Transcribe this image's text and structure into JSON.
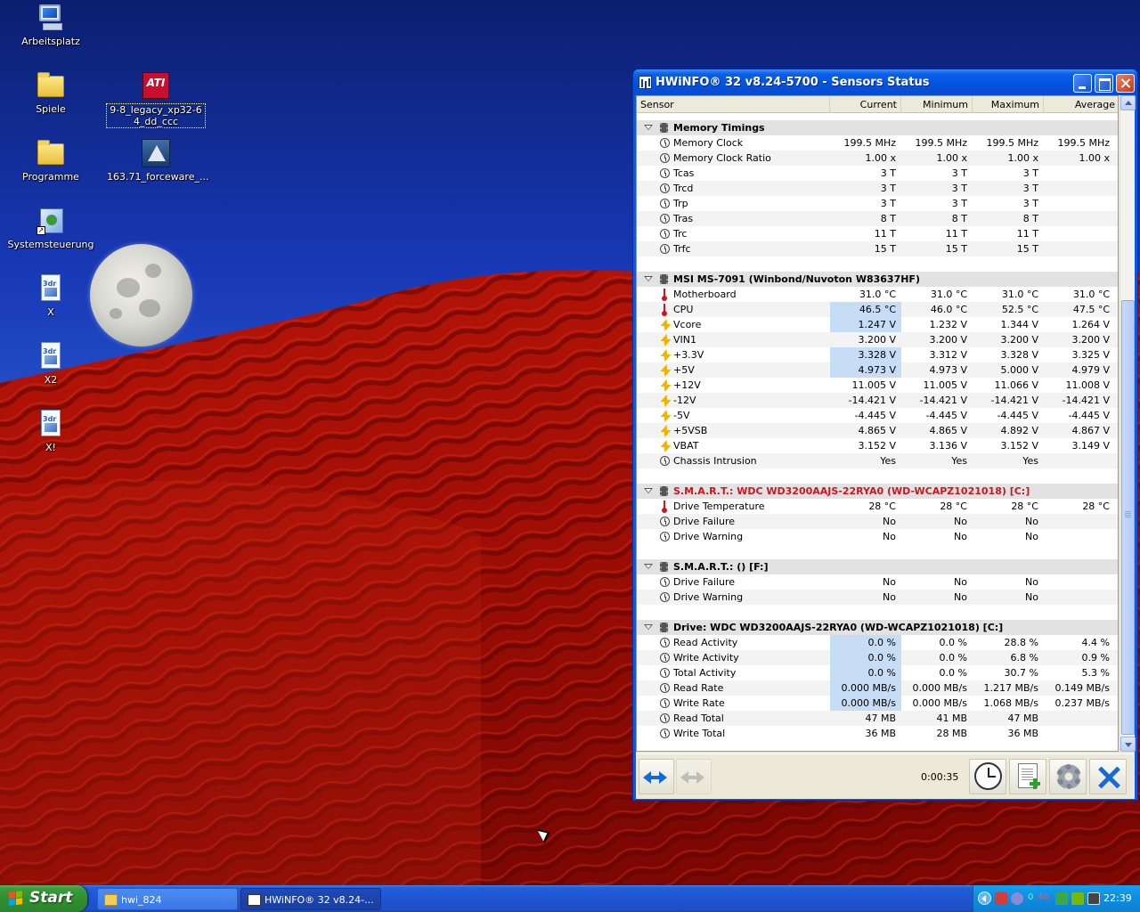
{
  "desktop": {
    "icons": [
      {
        "label": "Arbeitsplatz",
        "icon": "my-computer-icon"
      },
      {
        "label": "Spiele",
        "icon": "folder-icon"
      },
      {
        "label": "9-8_legacy_xp32-64_dd_ccc",
        "icon": "ati-radeon-icon"
      },
      {
        "label": "Programme",
        "icon": "folder-icon"
      },
      {
        "label": "163.71_forceware_...",
        "icon": "nvidia-installer-icon"
      },
      {
        "label": "Systemsteuerung",
        "icon": "control-panel-icon"
      },
      {
        "label": "X",
        "icon": "3dr-file-icon"
      },
      {
        "label": "X2",
        "icon": "3dr-file-icon"
      },
      {
        "label": "X!",
        "icon": "3dr-file-icon"
      }
    ],
    "ati_badge": "ATI",
    "doc_badge": "3dr"
  },
  "window": {
    "title": "HWiNFO® 32 v8.24-5700 - Sensors Status",
    "columns": [
      "Sensor",
      "Current",
      "Minimum",
      "Maximum",
      "Average"
    ],
    "groups": [
      {
        "name": "Memory Timings",
        "red": false,
        "rows": [
          {
            "icon": "clock",
            "name": "Memory Clock",
            "v": [
              "199.5 MHz",
              "199.5 MHz",
              "199.5 MHz",
              "199.5 MHz"
            ],
            "hl": false
          },
          {
            "icon": "clock",
            "name": "Memory Clock Ratio",
            "v": [
              "1.00 x",
              "1.00 x",
              "1.00 x",
              "1.00 x"
            ],
            "hl": false
          },
          {
            "icon": "clock",
            "name": "Tcas",
            "v": [
              "3 T",
              "3 T",
              "3 T",
              ""
            ],
            "hl": false
          },
          {
            "icon": "clock",
            "name": "Trcd",
            "v": [
              "3 T",
              "3 T",
              "3 T",
              ""
            ],
            "hl": false
          },
          {
            "icon": "clock",
            "name": "Trp",
            "v": [
              "3 T",
              "3 T",
              "3 T",
              ""
            ],
            "hl": false
          },
          {
            "icon": "clock",
            "name": "Tras",
            "v": [
              "8 T",
              "8 T",
              "8 T",
              ""
            ],
            "hl": false
          },
          {
            "icon": "clock",
            "name": "Trc",
            "v": [
              "11 T",
              "11 T",
              "11 T",
              ""
            ],
            "hl": false
          },
          {
            "icon": "clock",
            "name": "Trfc",
            "v": [
              "15 T",
              "15 T",
              "15 T",
              ""
            ],
            "hl": false
          }
        ]
      },
      {
        "name": "MSI MS-7091 (Winbond/Nuvoton W83637HF)",
        "red": false,
        "rows": [
          {
            "icon": "temp",
            "name": "Motherboard",
            "v": [
              "31.0 °C",
              "31.0 °C",
              "31.0 °C",
              "31.0 °C"
            ],
            "hl": false
          },
          {
            "icon": "temp",
            "name": "CPU",
            "v": [
              "46.5 °C",
              "46.0 °C",
              "52.5 °C",
              "47.5 °C"
            ],
            "hl": true
          },
          {
            "icon": "volt",
            "name": "Vcore",
            "v": [
              "1.247 V",
              "1.232 V",
              "1.344 V",
              "1.264 V"
            ],
            "hl": true
          },
          {
            "icon": "volt",
            "name": "VIN1",
            "v": [
              "3.200 V",
              "3.200 V",
              "3.200 V",
              "3.200 V"
            ],
            "hl": false
          },
          {
            "icon": "volt",
            "name": "+3.3V",
            "v": [
              "3.328 V",
              "3.312 V",
              "3.328 V",
              "3.325 V"
            ],
            "hl": true
          },
          {
            "icon": "volt",
            "name": "+5V",
            "v": [
              "4.973 V",
              "4.973 V",
              "5.000 V",
              "4.979 V"
            ],
            "hl": true
          },
          {
            "icon": "volt",
            "name": "+12V",
            "v": [
              "11.005 V",
              "11.005 V",
              "11.066 V",
              "11.008 V"
            ],
            "hl": false
          },
          {
            "icon": "volt",
            "name": "-12V",
            "v": [
              "-14.421 V",
              "-14.421 V",
              "-14.421 V",
              "-14.421 V"
            ],
            "hl": false
          },
          {
            "icon": "volt",
            "name": "-5V",
            "v": [
              "-4.445 V",
              "-4.445 V",
              "-4.445 V",
              "-4.445 V"
            ],
            "hl": false
          },
          {
            "icon": "volt",
            "name": "+5VSB",
            "v": [
              "4.865 V",
              "4.865 V",
              "4.892 V",
              "4.867 V"
            ],
            "hl": false
          },
          {
            "icon": "volt",
            "name": "VBAT",
            "v": [
              "3.152 V",
              "3.136 V",
              "3.152 V",
              "3.149 V"
            ],
            "hl": false
          },
          {
            "icon": "clock",
            "name": "Chassis Intrusion",
            "v": [
              "Yes",
              "Yes",
              "Yes",
              ""
            ],
            "hl": false
          }
        ]
      },
      {
        "name": "S.M.A.R.T.: WDC WD3200AAJS-22RYA0 (WD-WCAPZ1021018) [C:]",
        "red": true,
        "rows": [
          {
            "icon": "temp",
            "name": "Drive Temperature",
            "v": [
              "28 °C",
              "28 °C",
              "28 °C",
              "28 °C"
            ],
            "hl": false
          },
          {
            "icon": "clock",
            "name": "Drive Failure",
            "v": [
              "No",
              "No",
              "No",
              ""
            ],
            "hl": false
          },
          {
            "icon": "clock",
            "name": "Drive Warning",
            "v": [
              "No",
              "No",
              "No",
              ""
            ],
            "hl": false
          }
        ]
      },
      {
        "name": "S.M.A.R.T.:  () [F:]",
        "red": false,
        "rows": [
          {
            "icon": "clock",
            "name": "Drive Failure",
            "v": [
              "No",
              "No",
              "No",
              ""
            ],
            "hl": false
          },
          {
            "icon": "clock",
            "name": "Drive Warning",
            "v": [
              "No",
              "No",
              "No",
              ""
            ],
            "hl": false
          }
        ]
      },
      {
        "name": "Drive: WDC WD3200AAJS-22RYA0 (WD-WCAPZ1021018) [C:]",
        "red": false,
        "rows": [
          {
            "icon": "clock",
            "name": "Read Activity",
            "v": [
              "0.0 %",
              "0.0 %",
              "28.8 %",
              "4.4 %"
            ],
            "hl": true
          },
          {
            "icon": "clock",
            "name": "Write Activity",
            "v": [
              "0.0 %",
              "0.0 %",
              "6.8 %",
              "0.9 %"
            ],
            "hl": true
          },
          {
            "icon": "clock",
            "name": "Total Activity",
            "v": [
              "0.0 %",
              "0.0 %",
              "30.7 %",
              "5.3 %"
            ],
            "hl": true
          },
          {
            "icon": "clock",
            "name": "Read Rate",
            "v": [
              "0.000 MB/s",
              "0.000 MB/s",
              "1.217 MB/s",
              "0.149 MB/s"
            ],
            "hl": true
          },
          {
            "icon": "clock",
            "name": "Write Rate",
            "v": [
              "0.000 MB/s",
              "0.000 MB/s",
              "1.068 MB/s",
              "0.237 MB/s"
            ],
            "hl": true
          },
          {
            "icon": "clock",
            "name": "Read Total",
            "v": [
              "47 MB",
              "41 MB",
              "47 MB",
              ""
            ],
            "hl": false
          },
          {
            "icon": "clock",
            "name": "Write Total",
            "v": [
              "36 MB",
              "28 MB",
              "36 MB",
              ""
            ],
            "hl": false
          }
        ]
      }
    ],
    "timer": "0:00:35"
  },
  "taskbar": {
    "start_label": "Start",
    "tasks": [
      {
        "label": "hwi_824"
      },
      {
        "label": "HWiNFO® 32 v8.24-..."
      }
    ],
    "tray": {
      "count_green": "0",
      "count_red": "46",
      "time": "22:39"
    }
  },
  "colors": {
    "title_bar": "#0452de",
    "highlight_cell": "#c7dcf5",
    "group_row": "#e2e2e2",
    "red_group_text": "#d0141e",
    "start_button": "#2f8f2f"
  }
}
